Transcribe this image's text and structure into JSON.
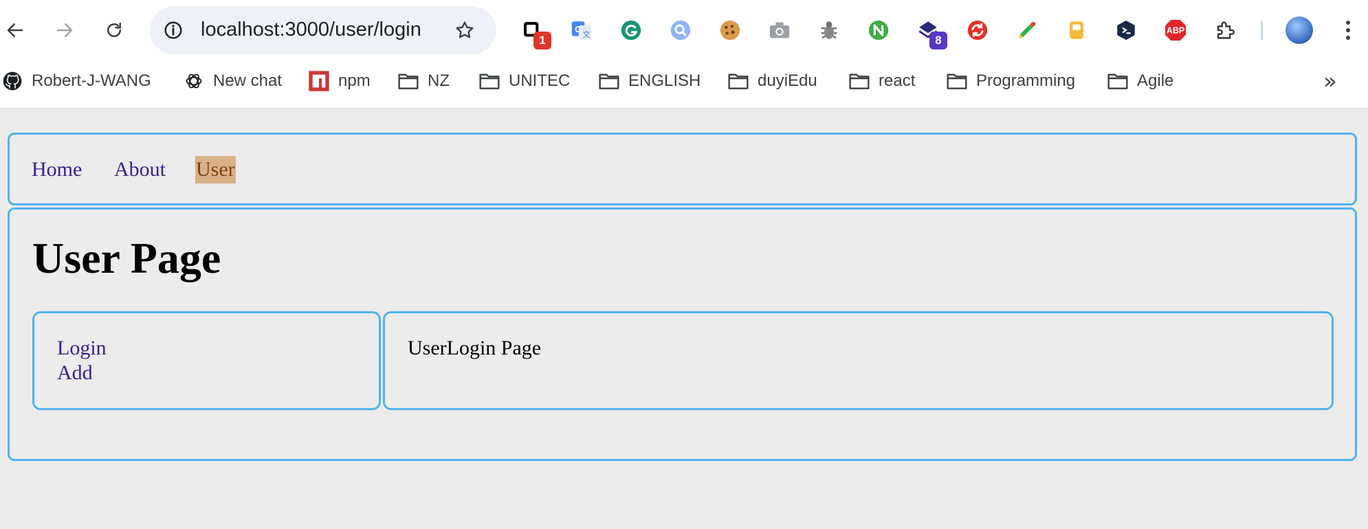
{
  "browser": {
    "url": "localhost:3000/user/login",
    "extensions": [
      {
        "name": "notion",
        "badge": "1",
        "badge_color": "#e0352b"
      },
      {
        "name": "google-translate"
      },
      {
        "name": "grammarly"
      },
      {
        "name": "search-lens"
      },
      {
        "name": "cookie"
      },
      {
        "name": "camera"
      },
      {
        "name": "bug"
      },
      {
        "name": "nodejs"
      },
      {
        "name": "layers",
        "badge": "8",
        "badge_color": "#5a35c8"
      },
      {
        "name": "sync"
      },
      {
        "name": "color-picker"
      },
      {
        "name": "clipboard"
      },
      {
        "name": "code"
      },
      {
        "name": "adblock-plus",
        "text": "ABP"
      },
      {
        "name": "extensions-puzzle"
      }
    ],
    "bookmarks": [
      {
        "label": "Robert-J-WANG",
        "icon": "github-icon"
      },
      {
        "label": "New chat",
        "icon": "openai-icon"
      },
      {
        "label": "npm",
        "icon": "npm-icon"
      },
      {
        "label": "NZ",
        "icon": "folder-icon"
      },
      {
        "label": "UNITEC",
        "icon": "folder-icon"
      },
      {
        "label": "ENGLISH",
        "icon": "folder-icon"
      },
      {
        "label": "duyiEdu",
        "icon": "folder-icon"
      },
      {
        "label": "react",
        "icon": "folder-icon"
      },
      {
        "label": "Programming",
        "icon": "folder-icon"
      },
      {
        "label": "Agile",
        "icon": "folder-icon"
      }
    ],
    "more_bookmarks": "»"
  },
  "nav": {
    "links": [
      {
        "label": "Home"
      },
      {
        "label": "About"
      },
      {
        "label": "User",
        "active": true
      }
    ]
  },
  "main": {
    "title": "User Page",
    "sidebar": {
      "links": [
        {
          "label": "Login"
        },
        {
          "label": "Add"
        }
      ]
    },
    "content": "UserLogin Page"
  },
  "colors": {
    "border": "#4fb3f0",
    "link": "#3b1d8f",
    "active_bg": "#d9b28a",
    "active_text": "#7a3f12",
    "page_bg": "#ececec"
  }
}
